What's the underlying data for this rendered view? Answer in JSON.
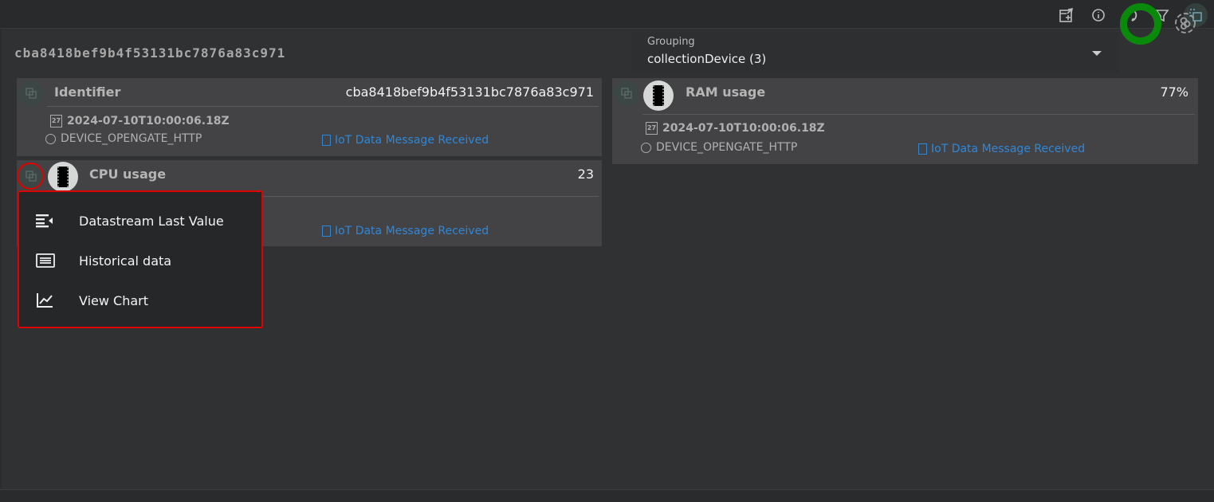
{
  "toolbar": {
    "icons": [
      "export-icon",
      "feedback-info-icon",
      "refresh-icon",
      "filter-icon",
      "multi-select-icon"
    ]
  },
  "header": {
    "device_id": "cba8418bef9b4f53131bc7876a83c971",
    "grouping": {
      "label": "Grouping",
      "value": "collectionDevice (3)"
    },
    "status_color": "#0a8a0a"
  },
  "cards": [
    {
      "title": "Identifier",
      "value": "cba8418bef9b4f53131bc7876a83c971",
      "date": "2024-07-10T10:00:06.18Z",
      "source": "DEVICE_OPENGATE_HTTP",
      "event": "IoT Data Message Received"
    },
    {
      "title": "CPU usage",
      "value": "23",
      "event": "IoT Data Message Received"
    },
    {
      "title": "RAM usage",
      "value": "77%",
      "date": "2024-07-10T10:00:06.18Z",
      "source": "DEVICE_OPENGATE_HTTP",
      "event": "IoT Data Message Received"
    }
  ],
  "menu": {
    "items": [
      {
        "label": "Datastream Last Value",
        "icon": "last-value-icon"
      },
      {
        "label": "Historical data",
        "icon": "list-icon"
      },
      {
        "label": "View Chart",
        "icon": "chart-icon"
      }
    ]
  },
  "colors": {
    "link": "#2f87d8",
    "highlight": "#e00000"
  }
}
